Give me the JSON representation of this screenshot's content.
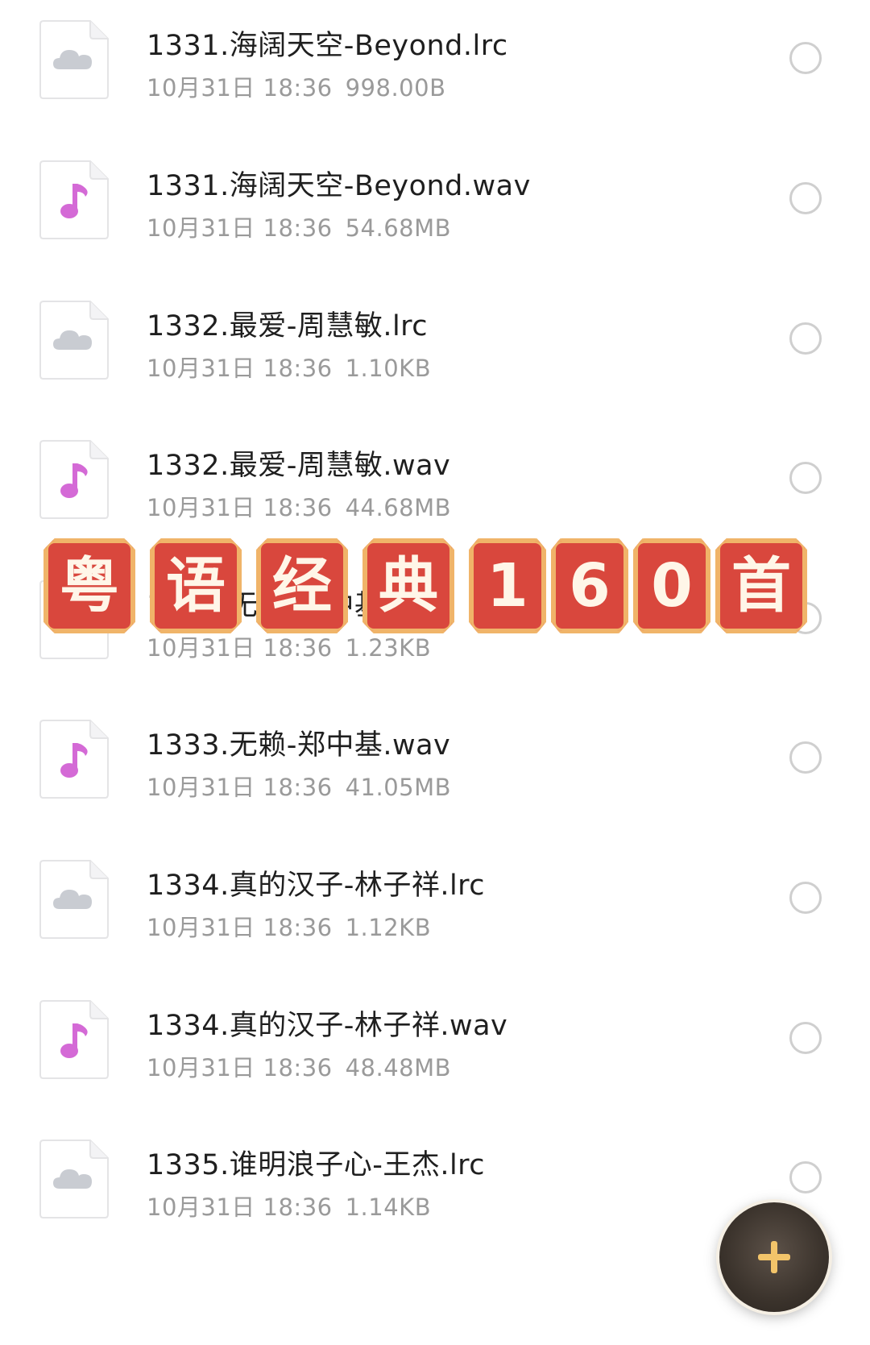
{
  "files": [
    {
      "name": "1331.海阔天空-Beyond.lrc",
      "date": "10月31日 18:36",
      "size": "998.00B",
      "type": "lyric",
      "icon": "cloud-file-icon"
    },
    {
      "name": "1331.海阔天空-Beyond.wav",
      "date": "10月31日 18:36",
      "size": "54.68MB",
      "type": "audio",
      "icon": "music-note-icon"
    },
    {
      "name": "1332.最爱-周慧敏.lrc",
      "date": "10月31日 18:36",
      "size": "1.10KB",
      "type": "lyric",
      "icon": "cloud-file-icon"
    },
    {
      "name": "1332.最爱-周慧敏.wav",
      "date": "10月31日 18:36",
      "size": "44.68MB",
      "type": "audio",
      "icon": "music-note-icon"
    },
    {
      "name": "1333.无赖-郑中基.lrc",
      "date": "10月31日 18:36",
      "size": "1.23KB",
      "type": "lyric",
      "icon": "cloud-file-icon"
    },
    {
      "name": "1333.无赖-郑中基.wav",
      "date": "10月31日 18:36",
      "size": "41.05MB",
      "type": "audio",
      "icon": "music-note-icon"
    },
    {
      "name": "1334.真的汉子-林子祥.lrc",
      "date": "10月31日 18:36",
      "size": "1.12KB",
      "type": "lyric",
      "icon": "cloud-file-icon"
    },
    {
      "name": "1334.真的汉子-林子祥.wav",
      "date": "10月31日 18:36",
      "size": "48.48MB",
      "type": "audio",
      "icon": "music-note-icon"
    },
    {
      "name": "1335.谁明浪子心-王杰.lrc",
      "date": "10月31日 18:36",
      "size": "1.14KB",
      "type": "lyric",
      "icon": "cloud-file-icon"
    }
  ],
  "banner": {
    "chars": [
      "粤",
      "语",
      "经",
      "典",
      "1",
      "6",
      "0",
      "首"
    ],
    "tile_color": "#d9473d",
    "border_color": "#f0b469"
  },
  "fab": {
    "label": "+",
    "icon": "plus-icon"
  },
  "colors": {
    "music_note": "#d46ad6",
    "cloud": "#c9ccd2",
    "name_text": "#1f1f1f",
    "meta_text": "#9a9a9a"
  }
}
